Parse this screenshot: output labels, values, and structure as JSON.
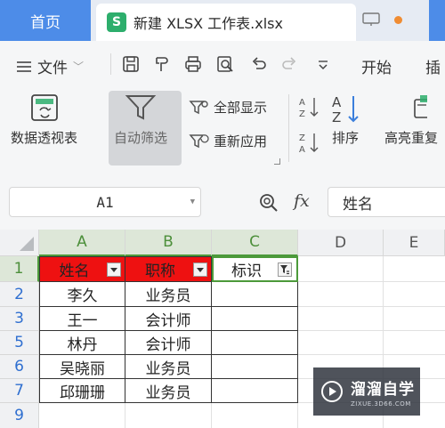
{
  "tabs": {
    "home": "首页",
    "file_icon_letter": "S",
    "file_title": "新建 XLSX 工作表.xlsx"
  },
  "menu": {
    "file": "文件",
    "start": "开始",
    "insert": "插"
  },
  "ribbon": {
    "pivot": "数据透视表",
    "autofilter": "自动筛选",
    "show_all": "全部显示",
    "reapply": "重新应用",
    "sort": "排序",
    "highlight_dup": "高亮重复"
  },
  "formula": {
    "cell_ref": "A1",
    "fx": "fx",
    "content": "姓名"
  },
  "sheet": {
    "columns": [
      "A",
      "B",
      "C",
      "D",
      "E"
    ],
    "rows": [
      "1",
      "2",
      "3",
      "5",
      "6",
      "7",
      "9"
    ],
    "header": [
      "姓名",
      "职称",
      "标识"
    ],
    "data": [
      [
        "李久",
        "业务员"
      ],
      [
        "王一",
        "会计师"
      ],
      [
        "林丹",
        "会计师"
      ],
      [
        "吴晓丽",
        "业务员"
      ],
      [
        "邱珊珊",
        "业务员"
      ]
    ]
  },
  "watermark": {
    "title": "溜溜自学",
    "url": "ZIXUE.3D66.COM"
  },
  "colors": {
    "accent": "#4d8ce8",
    "header_fill": "#ee1111",
    "selection": "#4c9a3a",
    "xlsx_icon": "#2dae6c"
  }
}
